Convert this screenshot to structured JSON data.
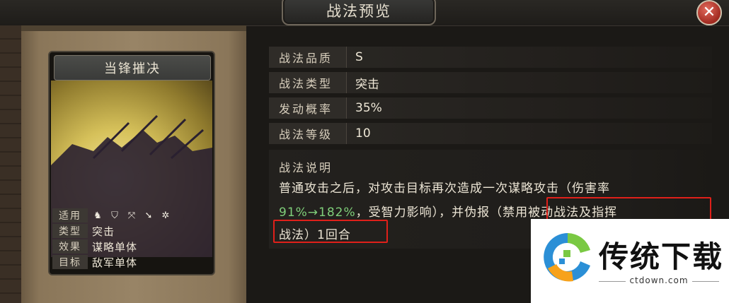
{
  "window": {
    "title": "战法预览",
    "close_label": "✕"
  },
  "card": {
    "name": "当锋摧决",
    "props": [
      {
        "label": "适用",
        "value": ""
      },
      {
        "label": "类型",
        "value": "突击"
      },
      {
        "label": "效果",
        "value": "谋略单体"
      },
      {
        "label": "目标",
        "value": "敌军单体"
      }
    ],
    "unit_icons": [
      "cavalry-icon",
      "shield-icon",
      "bow-icon",
      "spear-icon",
      "wheel-icon"
    ]
  },
  "info": {
    "rows": [
      {
        "label": "战法品质",
        "value": "S"
      },
      {
        "label": "战法类型",
        "value": "突击"
      },
      {
        "label": "发动概率",
        "value": "35%"
      },
      {
        "label": "战法等级",
        "value": "10"
      }
    ]
  },
  "description": {
    "title": "战法说明",
    "line1": "普通攻击之后，对攻击目标再次造成一次谋略攻击（伤害率",
    "line2_green": "91%→182%",
    "line2_rest": "，受智力影响），并伪报（禁用被动战法及指挥",
    "line3": "战法）1回合"
  },
  "watermark": {
    "brand": "传统下载",
    "url": "ctdown.com"
  },
  "colors": {
    "highlight": "#e0201a",
    "growth_green": "#7fcf7a"
  }
}
